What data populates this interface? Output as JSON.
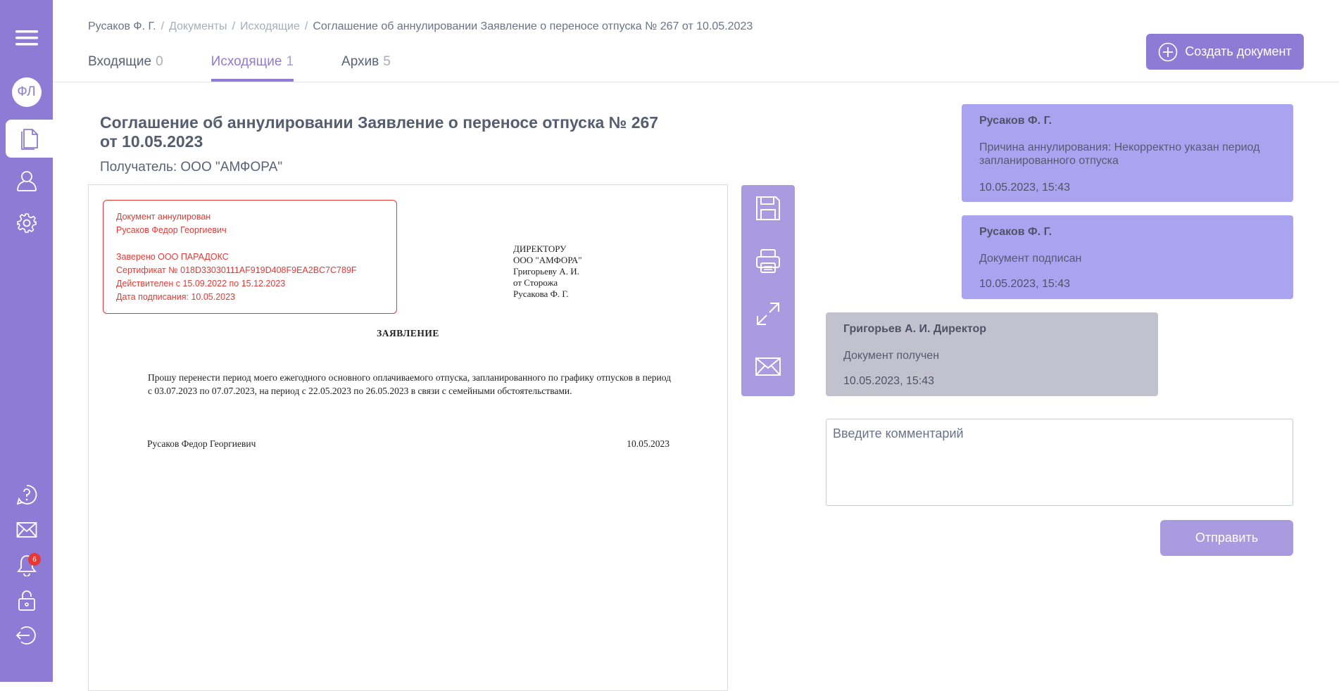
{
  "sidebar": {
    "avatar_initials": "ФЛ",
    "notifications_count": "6",
    "accent_color": "#8e7bd6",
    "items": [
      {
        "icon": "menu-icon"
      },
      {
        "icon": "avatar"
      },
      {
        "icon": "document-icon"
      },
      {
        "icon": "user-icon"
      },
      {
        "icon": "gear-icon"
      },
      {
        "icon": "help-icon"
      },
      {
        "icon": "mail-icon"
      },
      {
        "icon": "bell-icon"
      },
      {
        "icon": "lock-icon"
      },
      {
        "icon": "logout-icon"
      }
    ]
  },
  "breadcrumb": {
    "user": "Русаков Ф. Г.",
    "documents": "Документы",
    "outgoing": "Исходящие",
    "current": "Соглашение об аннулировании Заявление о переносе отпуска № 267 от 10.05.2023"
  },
  "tabs": [
    {
      "label": "Входящие",
      "count": "0"
    },
    {
      "label": "Исходящие",
      "count": "1"
    },
    {
      "label": "Архив",
      "count": "5"
    }
  ],
  "create_button": "Создать документ",
  "document": {
    "title": "Соглашение об аннулировании Заявление о переносе отпуска № 267 от 10.05.2023",
    "recipient": "Получатель: ООО \"АМФОРА\"",
    "stamp": {
      "line1": "Документ аннулирован",
      "line2": "Русаков Федор Георгиевич",
      "line3": "Заверено ООО ПАРАДОКС",
      "line4": "Сертификат № 018D33030111AF919D408F9EA2BC7C789F",
      "line5": "Действителен с 15.09.2022 по 15.12.2023",
      "line6": "Дата подписания: 10.05.2023"
    },
    "addressee": {
      "line1": "ДИРЕКТОРУ",
      "line2": "ООО \"АМФОРА\"",
      "line3": "Григорьеву А. И.",
      "line4": "от Сторожа",
      "line5": "Русакова Ф. Г."
    },
    "heading": "ЗАЯВЛЕНИЕ",
    "body": "Прошу перенести период моего ежегодного основного оплачиваемого отпуска, запланированного по графику отпусков в период с 03.07.2023 по 07.07.2023, на период с 22.05.2023 по 26.05.2023 в связи с семейными обстоятельствами.",
    "signer": "Русаков Федор Георгиевич",
    "date": "10.05.2023"
  },
  "tools": [
    {
      "icon": "save-icon"
    },
    {
      "icon": "print-icon"
    },
    {
      "icon": "expand-icon"
    },
    {
      "icon": "envelope-icon"
    }
  ],
  "messages": [
    {
      "author": "Русаков Ф. Г.",
      "text": "Причина аннулирования: Некорректно указан период запланированного отпуска",
      "time": "10.05.2023, 15:43"
    },
    {
      "author": "Русаков Ф. Г.",
      "text": "Документ подписан",
      "time": "10.05.2023, 15:43"
    },
    {
      "author": "Григорьев А. И. Директор",
      "text": "Документ получен",
      "time": "10.05.2023, 15:43"
    }
  ],
  "comment": {
    "placeholder": "Введите комментарий",
    "value": ""
  },
  "send_button": "Отправить"
}
